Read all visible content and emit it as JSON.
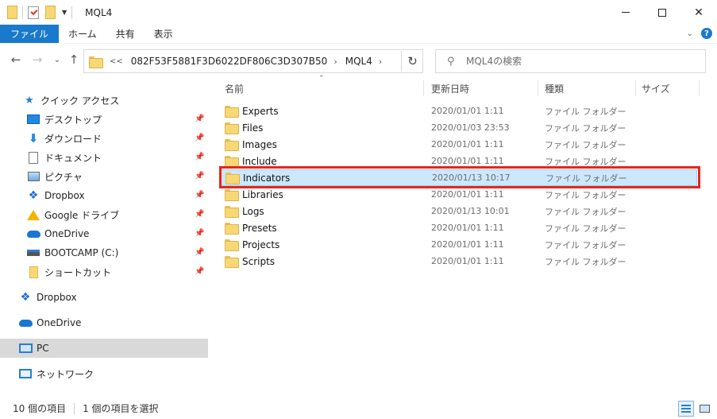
{
  "window": {
    "title": "MQL4"
  },
  "ribbon": {
    "tabs": [
      "ファイル",
      "ホーム",
      "共有",
      "表示"
    ]
  },
  "address": {
    "overflow": "<<",
    "crumbs": [
      "082F53F5881F3D6022DF806C3D307B50",
      "MQL4"
    ]
  },
  "search": {
    "placeholder": "MQL4の検索"
  },
  "sidebar": {
    "quick_access": "クイック アクセス",
    "quick_items": [
      {
        "label": "デスクトップ",
        "icon": "desktop-icon"
      },
      {
        "label": "ダウンロード",
        "icon": "download-icon"
      },
      {
        "label": "ドキュメント",
        "icon": "document-icon"
      },
      {
        "label": "ピクチャ",
        "icon": "pictures-icon"
      },
      {
        "label": "Dropbox",
        "icon": "dropbox-icon"
      },
      {
        "label": "Google ドライブ",
        "icon": "google-drive-icon"
      },
      {
        "label": "OneDrive",
        "icon": "onedrive-icon"
      },
      {
        "label": "BOOTCAMP (C:)",
        "icon": "drive-icon"
      },
      {
        "label": "ショートカット",
        "icon": "folder-icon"
      }
    ],
    "roots": [
      {
        "label": "Dropbox",
        "icon": "dropbox-icon"
      },
      {
        "label": "OneDrive",
        "icon": "onedrive-icon"
      },
      {
        "label": "PC",
        "icon": "pc-icon"
      },
      {
        "label": "ネットワーク",
        "icon": "network-icon"
      }
    ]
  },
  "columns": {
    "name": "名前",
    "date": "更新日時",
    "type": "種類",
    "size": "サイズ"
  },
  "files": [
    {
      "name": "Experts",
      "date": "2020/01/01 1:11",
      "type": "ファイル フォルダー"
    },
    {
      "name": "Files",
      "date": "2020/01/03 23:53",
      "type": "ファイル フォルダー"
    },
    {
      "name": "Images",
      "date": "2020/01/01 1:11",
      "type": "ファイル フォルダー"
    },
    {
      "name": "Include",
      "date": "2020/01/01 1:11",
      "type": "ファイル フォルダー"
    },
    {
      "name": "Indicators",
      "date": "2020/01/13 10:17",
      "type": "ファイル フォルダー"
    },
    {
      "name": "Libraries",
      "date": "2020/01/01 1:11",
      "type": "ファイル フォルダー"
    },
    {
      "name": "Logs",
      "date": "2020/01/13 10:01",
      "type": "ファイル フォルダー"
    },
    {
      "name": "Presets",
      "date": "2020/01/01 1:11",
      "type": "ファイル フォルダー"
    },
    {
      "name": "Projects",
      "date": "2020/01/01 1:11",
      "type": "ファイル フォルダー"
    },
    {
      "name": "Scripts",
      "date": "2020/01/01 1:11",
      "type": "ファイル フォルダー"
    }
  ],
  "status": {
    "item_count": "10 個の項目",
    "selected_count": "1 個の項目を選択"
  },
  "colors": {
    "accent": "#1979ca",
    "selection": "#cce8ff",
    "highlight": "#e8251a",
    "folder": "#f8d775"
  }
}
